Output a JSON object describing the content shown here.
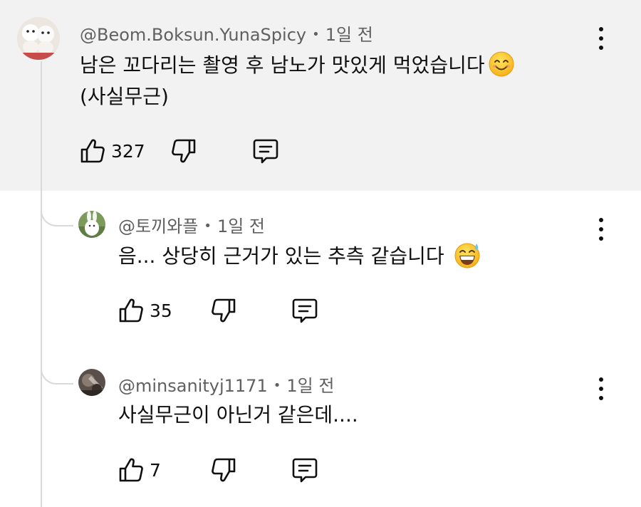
{
  "comments": [
    {
      "author": "@Beom.Boksun.YunaSpicy",
      "time": "1일 전",
      "text_line1": "남은 꼬다리는 촬영 후 남노가 맛있게 먹었습니다",
      "text_line2": "(사실무근)",
      "likes": "327"
    },
    {
      "author": "@토끼와플",
      "time": "1일 전",
      "text_line1": "음... 상당히 근거가 있는 추측 같습니다",
      "likes": "35"
    },
    {
      "author": "@minsanityj1171",
      "time": "1일 전",
      "text_line1": "사실무근이 아닌거 같은데....",
      "likes": "7"
    }
  ],
  "separator": "•",
  "icons": [
    "thumbs-up-icon",
    "thumbs-down-icon",
    "reply-icon",
    "more-vert-icon",
    "smiling-face-emoji",
    "grinning-sweat-emoji"
  ],
  "colors": {
    "parent_background": "#f2f2f2",
    "meta_text": "#606060",
    "thread_line": "#d9d9d9"
  }
}
